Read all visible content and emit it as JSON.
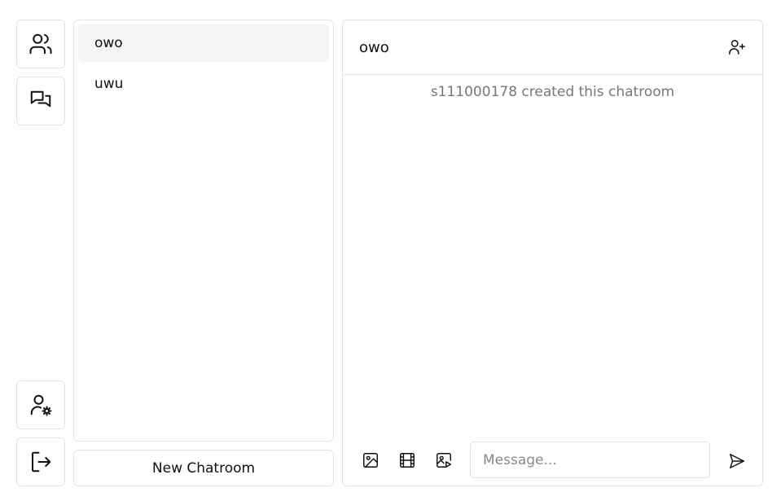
{
  "sidebar": {
    "icons": {
      "users": "users-icon",
      "chats": "chat-bubbles-icon",
      "profile": "user-settings-icon",
      "logout": "logout-icon"
    }
  },
  "room_list": {
    "rooms": [
      {
        "name": "owo",
        "active": true
      },
      {
        "name": "uwu",
        "active": false
      }
    ],
    "new_room_label": "New Chatroom"
  },
  "chat": {
    "title": "owo",
    "system_message": "s111000178 created this chatroom",
    "input_placeholder": "Message...",
    "icons": {
      "add_member": "user-plus-icon",
      "image": "image-icon",
      "video": "film-icon",
      "gif": "image-play-icon",
      "send": "send-icon"
    }
  },
  "colors": {
    "border": "#e3e3e3",
    "active_room_bg": "#f5f5f5",
    "muted_text": "#777777"
  }
}
